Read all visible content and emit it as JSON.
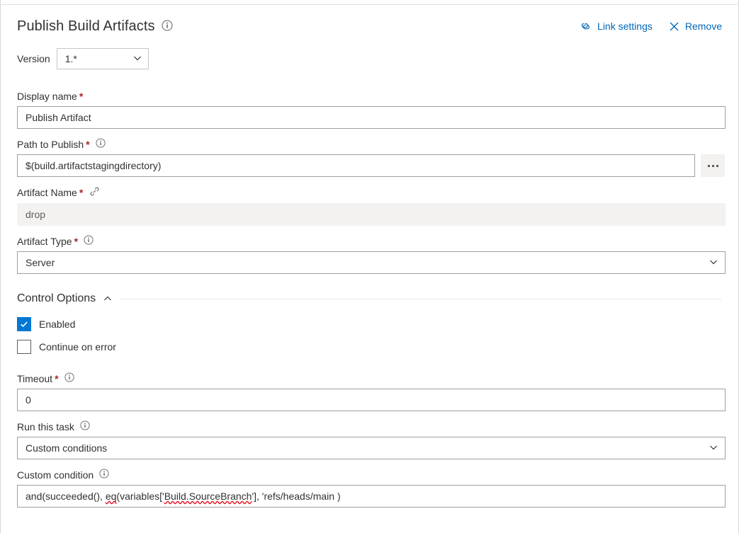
{
  "header": {
    "title": "Publish Build Artifacts",
    "info_icon": "info-icon",
    "link_settings_label": "Link settings",
    "link_settings_icon": "link-icon",
    "remove_label": "Remove",
    "remove_icon": "close-icon"
  },
  "version": {
    "label": "Version",
    "value": "1.*",
    "chevron_icon": "chevron-down-icon"
  },
  "fields": {
    "display_name": {
      "label": "Display name",
      "required": "*",
      "value": "Publish Artifact"
    },
    "path_to_publish": {
      "label": "Path to Publish",
      "required": "*",
      "info_icon": "info-icon",
      "value": "$(build.artifactstagingdirectory)",
      "browse_label": "..."
    },
    "artifact_name": {
      "label": "Artifact Name",
      "required": "*",
      "link_icon": "link-variable-icon",
      "value": "drop",
      "disabled": true
    },
    "artifact_type": {
      "label": "Artifact Type",
      "required": "*",
      "info_icon": "info-icon",
      "value": "Server",
      "chevron_icon": "chevron-down-icon"
    }
  },
  "control_options": {
    "section_title": "Control Options",
    "collapse_icon": "chevron-up-icon",
    "enabled": {
      "label": "Enabled",
      "checked": true
    },
    "continue_on_error": {
      "label": "Continue on error",
      "checked": false
    },
    "timeout": {
      "label": "Timeout",
      "required": "*",
      "info_icon": "info-icon",
      "value": "0"
    },
    "run_this_task": {
      "label": "Run this task",
      "info_icon": "info-icon",
      "value": "Custom conditions",
      "chevron_icon": "chevron-down-icon"
    },
    "custom_condition": {
      "label": "Custom condition",
      "info_icon": "info-icon",
      "value": "and(succeeded(), eq(variables['Build.SourceBranch'], 'refs/heads/main )",
      "segments": {
        "before_eq": "and(succeeded(), ",
        "eq": "eq",
        "mid": "(variables['",
        "variable": "Build.SourceBranch",
        "after": "'], 'refs/heads/main )"
      }
    }
  },
  "colors": {
    "accent": "#0078d4",
    "link": "#0067b8",
    "required": "#a4262c",
    "disabled_bg": "#f3f2f1",
    "border": "#a19f9d",
    "spellcheck": "#e81123"
  }
}
